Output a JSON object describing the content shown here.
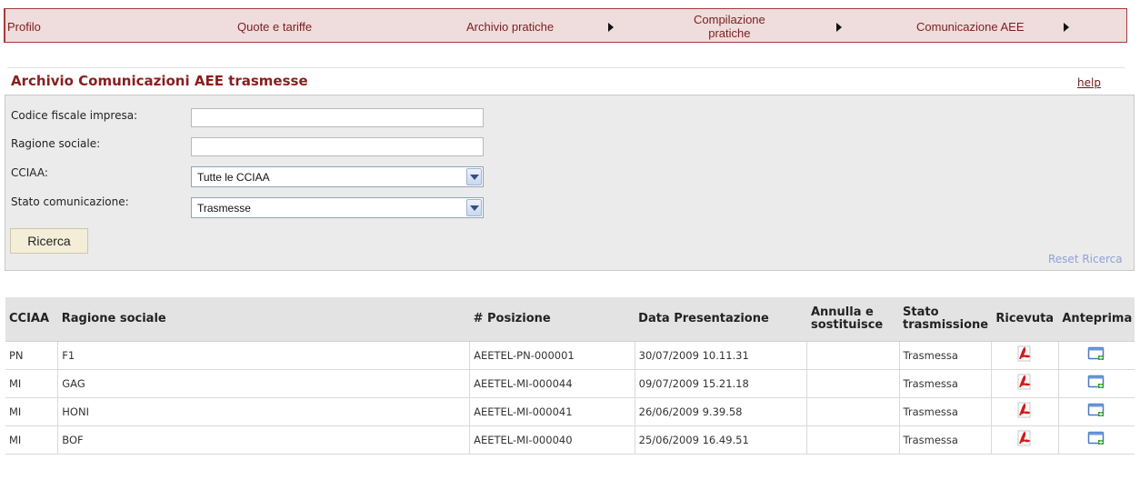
{
  "nav": {
    "items": [
      {
        "label": "Profilo"
      },
      {
        "label": "Quote e tariffe"
      },
      {
        "label": "Archivio pratiche"
      },
      {
        "label_line1": "Compilazione",
        "label_line2": "pratiche"
      },
      {
        "label": "Comunicazione AEE"
      }
    ]
  },
  "page": {
    "title": "Archivio Comunicazioni AEE trasmesse",
    "help_label": "help"
  },
  "search": {
    "fields": [
      {
        "label": "Codice fiscale impresa:",
        "value": ""
      },
      {
        "label": "Ragione sociale:",
        "value": ""
      },
      {
        "label": "CCIAA:",
        "value": "Tutte le CCIAA"
      },
      {
        "label": "Stato comunicazione:",
        "value": "Trasmesse"
      }
    ],
    "search_button": "Ricerca",
    "reset_label": "Reset Ricerca"
  },
  "table": {
    "headers": {
      "cciaa": "CCIAA",
      "ragione": "Ragione sociale",
      "posizione": "# Posizione",
      "data": "Data Presentazione",
      "annulla_1": "Annulla e",
      "annulla_2": "sostituisce",
      "stato_1": "Stato",
      "stato_2": "trasmissione",
      "ricevuta": "Ricevuta",
      "anteprima": "Anteprima"
    },
    "rows": [
      {
        "cciaa": "PN",
        "ragione": "F1",
        "posizione": "AEETEL-PN-000001",
        "data": "30/07/2009 10.11.31",
        "annulla": "",
        "stato": "Trasmessa"
      },
      {
        "cciaa": "MI",
        "ragione": "GAG",
        "posizione": "AEETEL-MI-000044",
        "data": "09/07/2009 15.21.18",
        "annulla": "",
        "stato": "Trasmessa"
      },
      {
        "cciaa": "MI",
        "ragione": "HONI",
        "posizione": "AEETEL-MI-000041",
        "data": "26/06/2009 9.39.58",
        "annulla": "",
        "stato": "Trasmessa"
      },
      {
        "cciaa": "MI",
        "ragione": "BOF",
        "posizione": "AEETEL-MI-000040",
        "data": "25/06/2009 16.49.51",
        "annulla": "",
        "stato": "Trasmessa"
      }
    ],
    "ricevuta_icon": "pdf-icon",
    "anteprima_icon": "preview-window-icon"
  },
  "colors": {
    "nav_background": "#efdcdc",
    "nav_border": "#a23c3c",
    "title": "#8a1e1e",
    "panel": "#ebebeb",
    "header_row": "#e3e3e3"
  }
}
